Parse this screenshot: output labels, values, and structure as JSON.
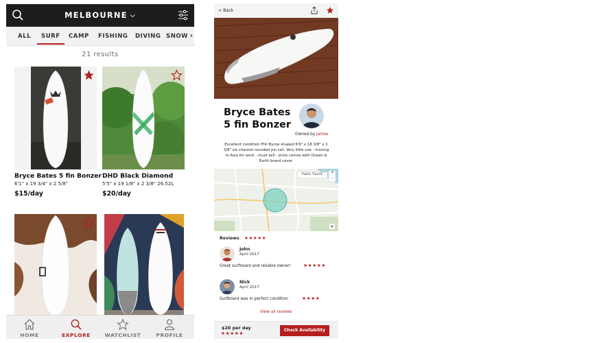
{
  "colors": {
    "accent": "#b61e1e",
    "topbar": "#1d1d1d"
  },
  "explore": {
    "location": "MELBOURNE",
    "location_icon": "chevron-down-icon",
    "categories": [
      "ALL",
      "SURF",
      "CAMP",
      "FISHING",
      "DIVING",
      "SNOW"
    ],
    "active_category": "SURF",
    "more_icon": "chevron-right-icon",
    "results": "21 results",
    "listings": [
      {
        "name": "Bryce Bates 5 fin Bonzer",
        "dims": "6'1\" x 19 3/4\" x 2 5/8\"",
        "price": "$15/day",
        "favorited": true
      },
      {
        "name": "DHD Black Diamond",
        "dims": "5'5\" x 19 1/8\" x 2 3/8\" 26.52L",
        "price": "$20/day",
        "favorited": false
      },
      {
        "name": "",
        "dims": "",
        "price": "",
        "favorited": false
      },
      {
        "name": "",
        "dims": "",
        "price": "",
        "favorited": false
      }
    ],
    "nav": [
      {
        "label": "HOME",
        "icon": "home-icon"
      },
      {
        "label": "EXPLORE",
        "icon": "search-icon"
      },
      {
        "label": "WATCHLIST",
        "icon": "star-icon"
      },
      {
        "label": "PROFILE",
        "icon": "profile-icon"
      }
    ],
    "active_nav": "EXPLORE"
  },
  "detail": {
    "back": "< Back",
    "title": "Bryce Bates 5 fin Bonzer",
    "owned_by": "Owned by",
    "owner": "James",
    "description": "Excellent condition Phil Byrne shaped 6'6\" x 18 3/8\" x 2 3/8\" six channel rounded pin tail. Very little use - moving to Asia for work - must sell - price comes with Ocean & Earth board cover.",
    "map": {
      "layer_label": "Public Transit",
      "zoom_in": "+",
      "zoom_out": "-"
    },
    "reviews_title": "Reviews",
    "overall_rating": 4.5,
    "overall_stars": "★★★★★",
    "reviews": [
      {
        "name": "John",
        "date": "April 2017",
        "text": "Great surfboard and reliable owner!",
        "rating": 5,
        "stars": "★★★★★"
      },
      {
        "name": "Nick",
        "date": "April 2017",
        "text": "Surfboard was in perfect condition",
        "rating": 4,
        "stars": "★★★★"
      }
    ],
    "view_all": "View all reviews",
    "price": "$20 per day",
    "price_stars": "★★★★★",
    "cta": "Check Availability"
  }
}
